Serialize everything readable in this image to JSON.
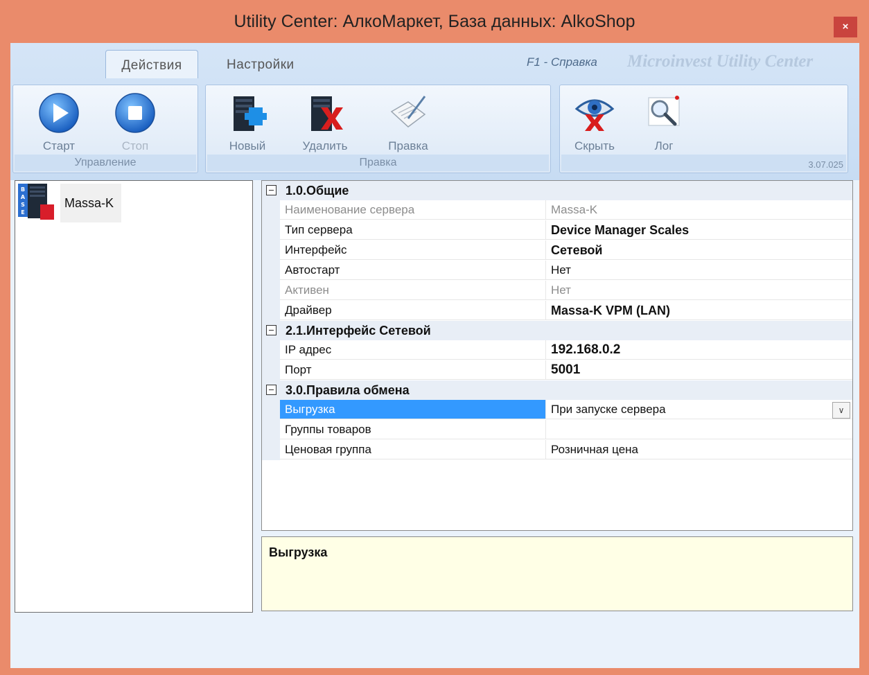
{
  "window": {
    "title": "Utility Center: АлкоМаркет, База данных: AlkoShop",
    "close": "×"
  },
  "ribbon": {
    "tabs": [
      {
        "label": "Действия"
      },
      {
        "label": "Настройки"
      }
    ],
    "help": "F1 - Справка",
    "brand": "Microinvest Utility Center",
    "version": "3.07.025",
    "groups": [
      {
        "title": "Управление",
        "buttons": [
          {
            "label": "Старт",
            "icon": "play-icon"
          },
          {
            "label": "Стоп",
            "icon": "stop-icon",
            "disabled": true
          }
        ]
      },
      {
        "title": "Правка",
        "buttons": [
          {
            "label": "Новый",
            "icon": "server-add-icon"
          },
          {
            "label": "Удалить",
            "icon": "server-delete-icon"
          },
          {
            "label": "Правка",
            "icon": "edit-document-icon"
          }
        ]
      },
      {
        "title": "",
        "buttons": [
          {
            "label": "Скрыть",
            "icon": "eye-hide-icon"
          },
          {
            "label": "Лог",
            "icon": "log-magnifier-icon"
          }
        ]
      }
    ]
  },
  "tree": {
    "items": [
      {
        "label": "Massa-K",
        "icon": "base-server-icon"
      }
    ]
  },
  "grid": {
    "categories": [
      {
        "title": "1.0.Общие",
        "rows": [
          {
            "name": "Наименование сервера",
            "value": "Massa-K"
          },
          {
            "name": "Тип сервера",
            "value": "Device Manager Scales"
          },
          {
            "name": "Интерфейс",
            "value": "Сетевой"
          },
          {
            "name": "Автостарт",
            "value": "Нет"
          },
          {
            "name": "Активен",
            "value": "Нет"
          },
          {
            "name": "Драйвер",
            "value": "Massa-K VPM (LAN)"
          }
        ]
      },
      {
        "title": "2.1.Интерфейс Сетевой",
        "rows": [
          {
            "name": "IP адрес",
            "value": "192.168.0.2"
          },
          {
            "name": "Порт",
            "value": "5001"
          }
        ]
      },
      {
        "title": "3.0.Правила обмена",
        "rows": [
          {
            "name": "Выгрузка",
            "value": "При запуске сервера"
          },
          {
            "name": "Группы товаров",
            "value": ""
          },
          {
            "name": "Ценовая группа",
            "value": "Розничная цена"
          }
        ]
      }
    ]
  },
  "description": {
    "title": "Выгрузка"
  },
  "colors": {
    "titlebar": "#ea8b6b",
    "close": "#c9443e",
    "selection": "#3399ff",
    "description_bg": "#ffffe6"
  }
}
